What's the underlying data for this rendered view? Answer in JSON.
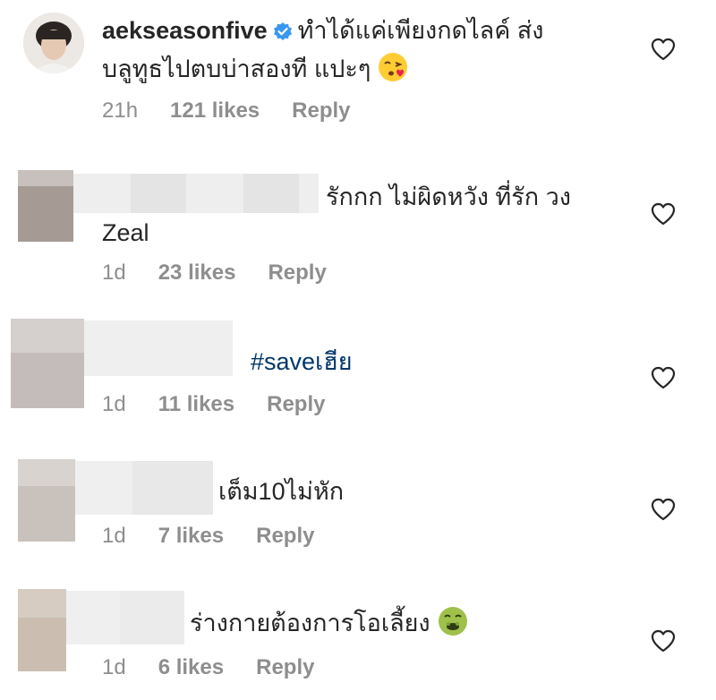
{
  "comments": [
    {
      "username": "aekseasonfive",
      "verified": true,
      "line1": "ทำได้แค่เพียงกดไลค์ ส่ง",
      "line2": "บลูทูธไปตบบ่าสองที แปะๆ",
      "emoji": "face-blowing-kiss-emoji",
      "time": "21h",
      "likes": "121 likes",
      "reply": "Reply"
    },
    {
      "line1": "รักกก ไม่ผิดหวัง ที่รัก วง",
      "line2": "Zeal",
      "time": "1d",
      "likes": "23 likes",
      "reply": "Reply"
    },
    {
      "line1": "#saveเฮีย",
      "time": "1d",
      "likes": "11 likes",
      "reply": "Reply"
    },
    {
      "line1": "เต็ม10ไม่หัก",
      "time": "1d",
      "likes": "7 likes",
      "reply": "Reply"
    },
    {
      "line1": "ร่างกายต้องการโอเลี้ยง",
      "emoji": "nauseated-face-emoji",
      "time": "1d",
      "likes": "6 likes",
      "reply": "Reply"
    }
  ],
  "icons": {
    "like": "heart-icon",
    "verified": "verified-badge-icon"
  },
  "colors": {
    "text": "#262626",
    "meta": "#8e8e8e",
    "hashtag": "#00376b",
    "verified": "#3897f0"
  }
}
